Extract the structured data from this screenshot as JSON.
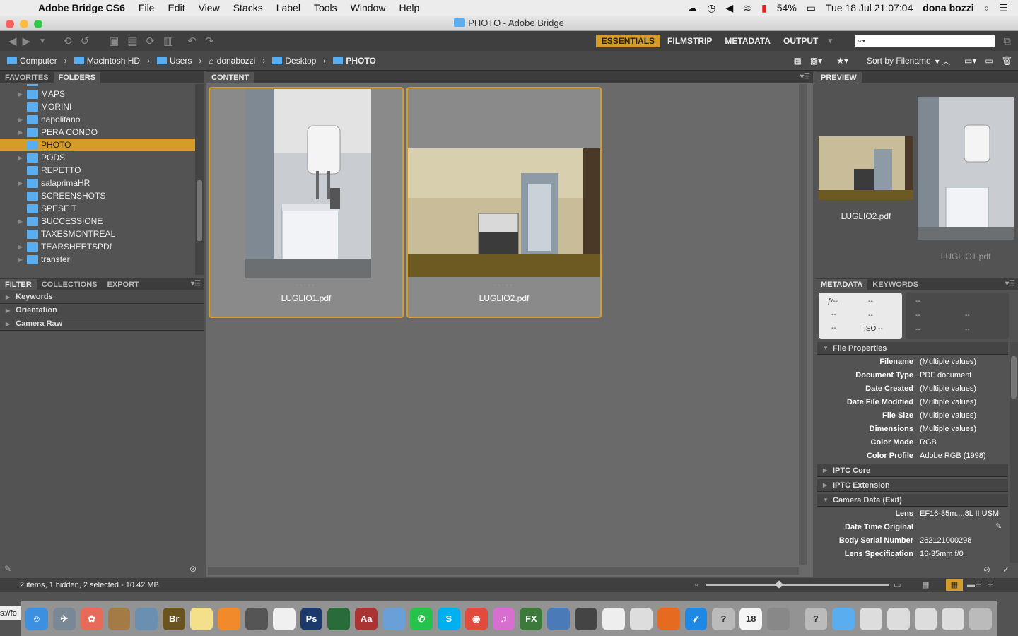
{
  "menubar": {
    "app": "Adobe Bridge CS6",
    "items": [
      "File",
      "Edit",
      "View",
      "Stacks",
      "Label",
      "Tools",
      "Window",
      "Help"
    ],
    "battery": "54%",
    "clock": "Tue 18 Jul  21:07:04",
    "user": "dona bozzi"
  },
  "window": {
    "title": "PHOTO - Adobe Bridge"
  },
  "toolbar": {
    "workspaces": [
      "ESSENTIALS",
      "FILMSTRIP",
      "METADATA",
      "OUTPUT"
    ],
    "search_placeholder": "⌕▾"
  },
  "pathbar": {
    "crumbs": [
      "Computer",
      "Macintosh HD",
      "Users",
      "donabozzi",
      "Desktop",
      "PHOTO"
    ],
    "sort_label": "Sort by Filename"
  },
  "folders_panel": {
    "tabs": [
      "FAVORITES",
      "FOLDERS"
    ],
    "items": [
      {
        "label": "MAILCONTROPARTE e barbieri",
        "expandable": false
      },
      {
        "label": "MAPS",
        "expandable": true
      },
      {
        "label": "MORINI",
        "expandable": false
      },
      {
        "label": "napolitano",
        "expandable": true
      },
      {
        "label": "PERA CONDO",
        "expandable": true
      },
      {
        "label": "PHOTO",
        "expandable": false,
        "selected": true
      },
      {
        "label": "PODS",
        "expandable": true
      },
      {
        "label": "REPETTO",
        "expandable": false
      },
      {
        "label": "salaprimaHR",
        "expandable": true
      },
      {
        "label": "SCREENSHOTS",
        "expandable": false
      },
      {
        "label": "SPESE T",
        "expandable": false
      },
      {
        "label": "SUCCESSIONE",
        "expandable": true
      },
      {
        "label": "TAXESMONTREAL",
        "expandable": false
      },
      {
        "label": "TEARSHEETSPDf",
        "expandable": true
      },
      {
        "label": "transfer",
        "expandable": true
      }
    ]
  },
  "filter_panel": {
    "tabs": [
      "FILTER",
      "COLLECTIONS",
      "EXPORT"
    ],
    "sections": [
      "Keywords",
      "Orientation",
      "Camera Raw"
    ]
  },
  "content_panel": {
    "tab": "CONTENT",
    "items": [
      {
        "filename": "LUGLIO1.pdf",
        "orientation": "portrait"
      },
      {
        "filename": "LUGLIO2.pdf",
        "orientation": "landscape"
      }
    ]
  },
  "preview_panel": {
    "tab": "PREVIEW",
    "items": [
      "LUGLIO2.pdf",
      "LUGLIO1.pdf"
    ]
  },
  "metadata_panel": {
    "tabs": [
      "METADATA",
      "KEYWORDS"
    ],
    "placard": {
      "fstop": "ƒ/--",
      "shutter": "--",
      "a": "--",
      "b": "--",
      "c": "--",
      "iso": "ISO --",
      "r1": "--",
      "r2": "--",
      "r3": "--",
      "r4": "--",
      "r5": "--"
    },
    "file_properties_title": "File Properties",
    "file_properties": [
      {
        "key": "Filename",
        "value": "(Multiple values)"
      },
      {
        "key": "Document Type",
        "value": "PDF document"
      },
      {
        "key": "Date Created",
        "value": "(Multiple values)"
      },
      {
        "key": "Date File Modified",
        "value": "(Multiple values)"
      },
      {
        "key": "File Size",
        "value": "(Multiple values)"
      },
      {
        "key": "Dimensions",
        "value": "(Multiple values)"
      },
      {
        "key": "Color Mode",
        "value": "RGB"
      },
      {
        "key": "Color Profile",
        "value": "Adobe RGB (1998)"
      }
    ],
    "iptc_core": "IPTC Core",
    "iptc_extension": "IPTC Extension",
    "camera_data_title": "Camera Data (Exif)",
    "camera_data": [
      {
        "key": "Lens",
        "value": "EF16-35m....8L II USM"
      },
      {
        "key": "Date Time Original",
        "value": ""
      },
      {
        "key": "Body Serial Number",
        "value": "262121000298"
      },
      {
        "key": "Lens Specification",
        "value": "16-35mm f/0"
      }
    ]
  },
  "statusbar": {
    "text": "2 items, 1 hidden, 2 selected - 10.42 MB"
  },
  "dock": {
    "left_stub": "s://fo",
    "apps": [
      {
        "name": "finder-icon",
        "color": "#3d8fe0",
        "glyph": "☺"
      },
      {
        "name": "launchpad-icon",
        "color": "#7a8794",
        "glyph": "✈"
      },
      {
        "name": "photos-icon",
        "color": "#e86b5a",
        "glyph": "✿"
      },
      {
        "name": "notes-book-icon",
        "color": "#a47b45",
        "glyph": ""
      },
      {
        "name": "preview-icon",
        "color": "#6b8fb0",
        "glyph": ""
      },
      {
        "name": "bridge-icon",
        "color": "#6b5320",
        "glyph": "Br"
      },
      {
        "name": "notes-icon",
        "color": "#f4e08a",
        "glyph": ""
      },
      {
        "name": "books-icon",
        "color": "#f08a2a",
        "glyph": ""
      },
      {
        "name": "calculator-icon",
        "color": "#555",
        "glyph": ""
      },
      {
        "name": "reminders-icon",
        "color": "#f0f0f0",
        "glyph": ""
      },
      {
        "name": "photoshop-icon",
        "color": "#1b3a6b",
        "glyph": "Ps"
      },
      {
        "name": "grid-app-icon",
        "color": "#2a6b3a",
        "glyph": ""
      },
      {
        "name": "dictionary-icon",
        "color": "#a33",
        "glyph": "Aa"
      },
      {
        "name": "mail-icon",
        "color": "#6aa0d8",
        "glyph": ""
      },
      {
        "name": "whatsapp-icon",
        "color": "#27c24c",
        "glyph": "✆"
      },
      {
        "name": "skype-icon",
        "color": "#00aff0",
        "glyph": "S"
      },
      {
        "name": "chrome-icon",
        "color": "#e24a3b",
        "glyph": "◉"
      },
      {
        "name": "itunes-icon",
        "color": "#d86fd0",
        "glyph": "♫"
      },
      {
        "name": "fx-icon",
        "color": "#3b7a3b",
        "glyph": "FX"
      },
      {
        "name": "wave-app-icon",
        "color": "#4a7ab8",
        "glyph": ""
      },
      {
        "name": "final-cut-icon",
        "color": "#444",
        "glyph": ""
      },
      {
        "name": "textedit-icon",
        "color": "#eee",
        "glyph": ""
      },
      {
        "name": "pages-icon",
        "color": "#ddd",
        "glyph": ""
      },
      {
        "name": "firefox-icon",
        "color": "#e66a1f",
        "glyph": ""
      },
      {
        "name": "safari-icon",
        "color": "#1e88e5",
        "glyph": "➶"
      },
      {
        "name": "unknown-app-icon",
        "color": "#bbb",
        "glyph": "?"
      },
      {
        "name": "calendar-icon",
        "color": "#f5f5f5",
        "glyph": "18"
      },
      {
        "name": "keychain-icon",
        "color": "#888",
        "glyph": ""
      },
      {
        "name": "unknown-app-2-icon",
        "color": "#bbb",
        "glyph": "?"
      },
      {
        "name": "folder-icon",
        "color": "#5aaef0",
        "glyph": ""
      },
      {
        "name": "doc-stack-icon",
        "color": "#ddd",
        "glyph": ""
      },
      {
        "name": "doc-stack-2-icon",
        "color": "#ddd",
        "glyph": ""
      },
      {
        "name": "doc-stack-3-icon",
        "color": "#ddd",
        "glyph": ""
      },
      {
        "name": "doc-stack-4-icon",
        "color": "#ddd",
        "glyph": ""
      },
      {
        "name": "trash-icon",
        "color": "#bbb",
        "glyph": ""
      }
    ]
  },
  "colors": {
    "accent": "#d69c2a",
    "folder": "#5aaef0"
  }
}
